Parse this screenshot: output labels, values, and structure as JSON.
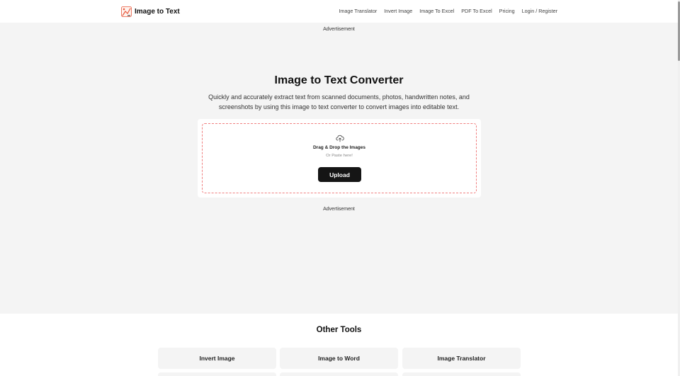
{
  "header": {
    "logo_text": "Image to Text",
    "logo_icon": "image-to-text-logo",
    "nav": [
      {
        "label": "Image Translator"
      },
      {
        "label": "Invert Image"
      },
      {
        "label": "Image To Excel"
      },
      {
        "label": "PDF To Excel"
      },
      {
        "label": "Pricing"
      },
      {
        "label": "Login / Register"
      }
    ]
  },
  "hero": {
    "ad_top": "Advertisement",
    "title": "Image to Text Converter",
    "subtitle": "Quickly and accurately extract text from scanned documents, photos, handwritten notes, and screenshots by using this image to text converter to convert images into editable text.",
    "ad_bottom": "Advertisement"
  },
  "upload": {
    "icon": "cloud-upload-icon",
    "drag_text": "Drag & Drop the Images",
    "paste_text": "Or Paste here!",
    "button_label": "Upload",
    "dropzone_border_color": "#f07f7f"
  },
  "other_tools": {
    "title": "Other Tools",
    "items": [
      {
        "label": "Invert Image"
      },
      {
        "label": "Image to Word"
      },
      {
        "label": "Image Translator"
      }
    ]
  },
  "colors": {
    "hero_bg": "#f4f4f4",
    "button_bg": "#151515",
    "logo_accent": "#e8573c"
  }
}
